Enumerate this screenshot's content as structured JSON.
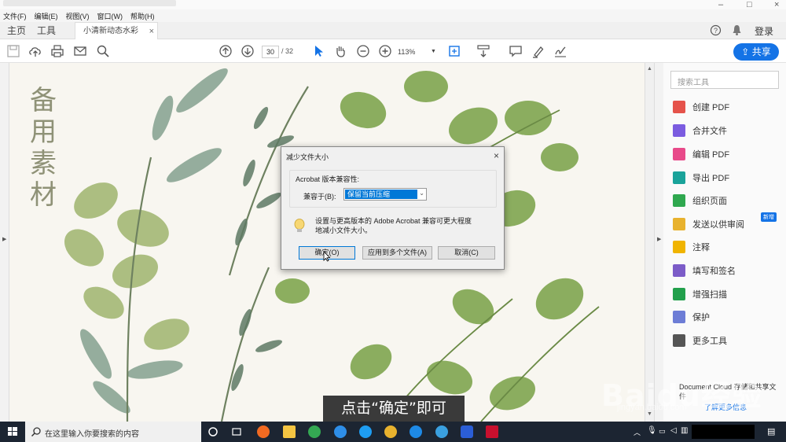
{
  "menu": [
    "文件(F)",
    "编辑(E)",
    "视图(V)",
    "窗口(W)",
    "帮助(H)"
  ],
  "tabs": {
    "home": "主页",
    "tools": "工具",
    "document": "小清新动态水彩绿...",
    "close": "×"
  },
  "header": {
    "login": "登录",
    "share": "共享"
  },
  "toolbar": {
    "page_current": "30",
    "page_total": "/ 32",
    "zoom": "113%"
  },
  "page": {
    "vertical_title": "备用素材"
  },
  "panel": {
    "search_placeholder": "搜索工具",
    "tools": [
      {
        "label": "创建 PDF",
        "color": "#e5534b"
      },
      {
        "label": "合并文件",
        "color": "#7b5ce0"
      },
      {
        "label": "编辑 PDF",
        "color": "#e84a8a"
      },
      {
        "label": "导出 PDF",
        "color": "#1aa39a"
      },
      {
        "label": "组织页面",
        "color": "#2fa84f"
      },
      {
        "label": "发送以供审阅",
        "color": "#e8b22e"
      },
      {
        "label": "注释",
        "color": "#f0b400"
      },
      {
        "label": "填写和签名",
        "color": "#7c5cc8"
      },
      {
        "label": "增强扫描",
        "color": "#22a04c"
      },
      {
        "label": "保护",
        "color": "#6d7dd6"
      },
      {
        "label": "更多工具",
        "color": "#555555"
      }
    ],
    "new_badge": "新增",
    "cloud_text": "Document Cloud 存储和共享文件",
    "learn_more": "了解更多信息"
  },
  "dialog": {
    "title": "减少文件大小",
    "close": "×",
    "group_label": "Acrobat 版本兼容性:",
    "compat_label": "兼容于(B):",
    "compat_value": "保留当前压缩",
    "message": "设置与更高版本的 Adobe Acrobat 兼容可更大程度地减小文件大小。",
    "ok": "确定(O)",
    "apply_multiple": "应用到多个文件(A)",
    "cancel": "取消(C)"
  },
  "caption": "点击“确定”即可",
  "watermark": {
    "brand": "Baidu经验",
    "url": "jingyan.baidu.com"
  },
  "taskbar": {
    "search_placeholder": "在这里输入你要搜索的内容"
  }
}
